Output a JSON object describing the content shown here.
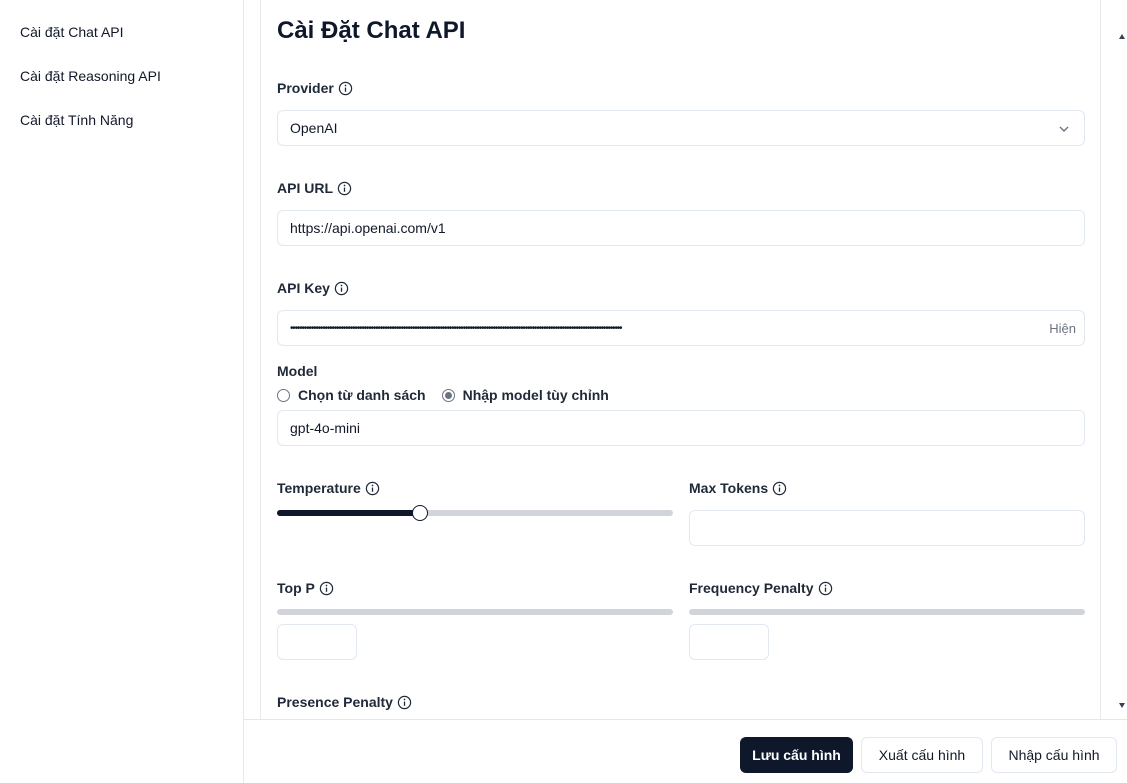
{
  "sidebar": {
    "items": [
      {
        "label": "Cài đặt Chat API"
      },
      {
        "label": "Cài đặt Reasoning API"
      },
      {
        "label": "Cài đặt Tính Năng"
      }
    ]
  },
  "page": {
    "title": "Cài Đặt Chat API"
  },
  "form": {
    "provider": {
      "label": "Provider",
      "value": "OpenAI"
    },
    "api_url": {
      "label": "API URL",
      "value": "https://api.openai.com/v1"
    },
    "api_key": {
      "label": "API Key",
      "masked_value": "••••••••••••••••••••••••••••••••••••••••••••••••••••••••••••••••••••••••••••••••••••••••••••••••••••••••••••••••••••••••••••••••••••••••••••••••",
      "toggle_label": "Hiện"
    },
    "model": {
      "label": "Model",
      "option_list": "Chọn từ danh sách",
      "option_custom": "Nhập model tùy chỉnh",
      "selected": "custom",
      "value": "gpt-4o-mini"
    },
    "temperature": {
      "label": "Temperature",
      "level": 0.36
    },
    "max_tokens": {
      "label": "Max Tokens",
      "value": ""
    },
    "top_p": {
      "label": "Top P",
      "value": ""
    },
    "frequency_penalty": {
      "label": "Frequency Penalty",
      "value": ""
    },
    "presence_penalty": {
      "label": "Presence Penalty"
    }
  },
  "footer": {
    "save_label": "Lưu cấu hình",
    "export_label": "Xuất cấu hình",
    "import_label": "Nhập cấu hình"
  },
  "colors": {
    "primary": "#0f172a",
    "border": "#e2e8f0",
    "track": "#d1d5db"
  },
  "icons": {
    "info": "info-circle-icon",
    "chevron": "chevron-down-icon"
  }
}
